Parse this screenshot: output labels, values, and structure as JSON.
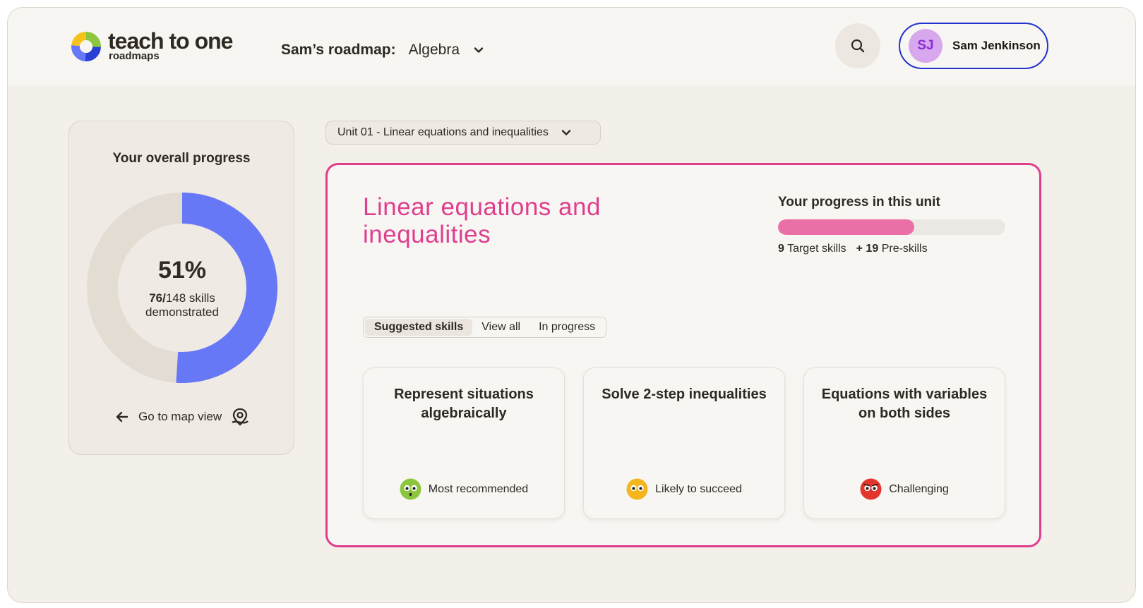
{
  "header": {
    "logo_word": "teach to one",
    "logo_sub": "roadmaps",
    "roadmap_label": "Sam’s roadmap:",
    "roadmap_value": "Algebra",
    "user_initials": "SJ",
    "user_name": "Sam Jenkinson"
  },
  "overall": {
    "title": "Your overall progress",
    "percent_label": "51%",
    "percent": 51,
    "skills_done": "76/",
    "skills_total": "148 skills",
    "skills_suffix": "demonstrated",
    "map_link": "Go to map view"
  },
  "unit_select": {
    "value": "Unit 01 - Linear equations and inequalities"
  },
  "unit": {
    "title": "Linear equations and inequalities",
    "progress_label": "Your progress in this unit",
    "progress_fraction": 0.6,
    "target_count": "9",
    "target_label": "Target skills",
    "pre_count": "+ 19",
    "pre_label": "Pre-skills"
  },
  "tabs": [
    "Suggested skills",
    "View all",
    "In progress"
  ],
  "cards": [
    {
      "title": "Represent situations algebraically",
      "tag": "Most recommended",
      "face_color": "#8cc63f"
    },
    {
      "title": "Solve 2-step inequalities",
      "tag": "Likely to succeed",
      "face_color": "#f5b51c"
    },
    {
      "title": "Equations with variables on both sides",
      "tag": "Challenging",
      "face_color": "#e2352d"
    }
  ],
  "colors": {
    "accent_pink": "#df3e8d",
    "donut_fill": "#6678f5",
    "donut_track": "#e3dcd2",
    "bar_fill": "#ea6fa6",
    "user_border": "#2233cc"
  }
}
